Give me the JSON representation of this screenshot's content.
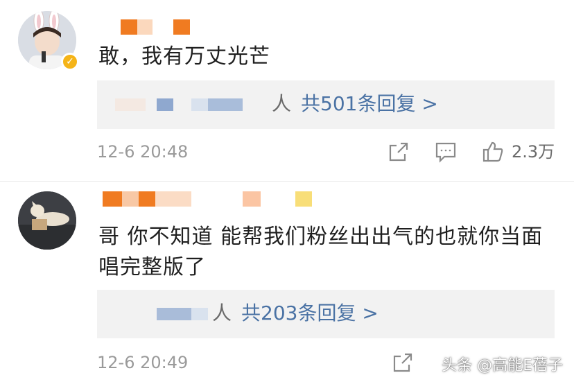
{
  "comments": [
    {
      "text": "敢，我有万丈光芒",
      "reply_suffix": "人",
      "reply_link": "共501条回复 >",
      "timestamp": "12-6 20:48",
      "like_count": "2.3万"
    },
    {
      "text": "哥 你不知道 能帮我们粉丝出出气的也就你当面唱完整版了",
      "reply_suffix": "人",
      "reply_link": "共203条回复 >",
      "timestamp": "12-6 20:49"
    }
  ],
  "watermark": "头条 @高能E蓓子",
  "colors": {
    "link": "#4a72a4",
    "timestamp": "#9a9a9a",
    "reply_box_bg": "#f2f2f2",
    "verified_badge": "#f5b418",
    "censor_orange": "#f07b21",
    "censor_blue": "#8fa8cf",
    "censor_yellow": "#f8de78"
  },
  "icons": [
    "share-icon",
    "comment-icon",
    "thumbs-up-icon",
    "verified-badge-icon"
  ]
}
